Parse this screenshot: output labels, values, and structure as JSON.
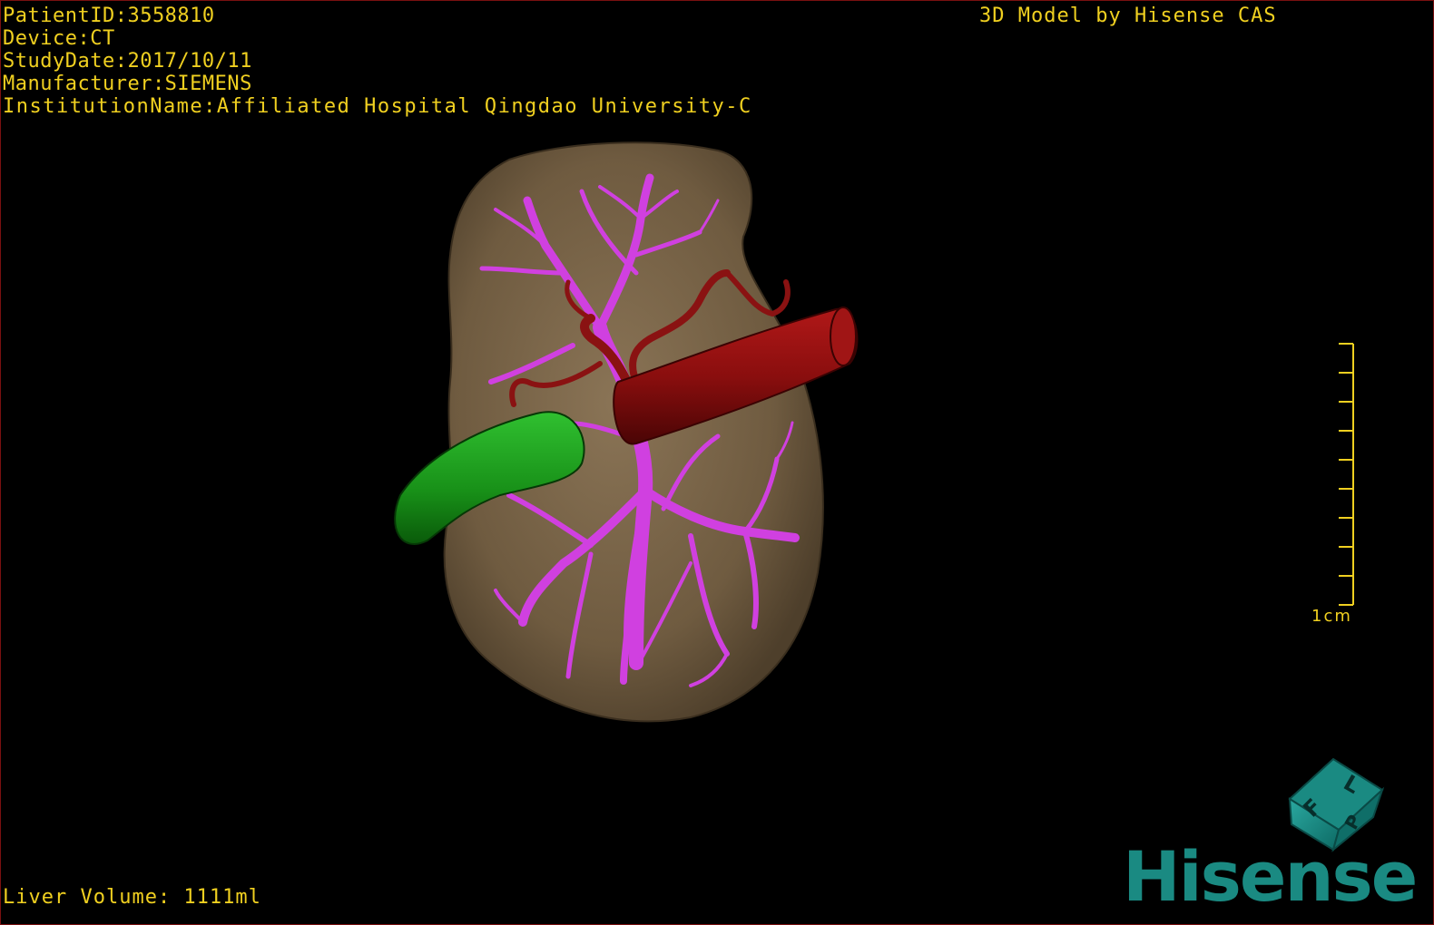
{
  "patient_info": {
    "patient_id": "PatientID:3558810",
    "device": "Device:CT",
    "study_date": "StudyDate:2017/10/11",
    "manufacturer": "Manufacturer:SIEMENS",
    "institution": "InstitutionName:Affiliated Hospital Qingdao University-C"
  },
  "header": {
    "model_credit": "3D Model by Hisense CAS"
  },
  "footer": {
    "liver_volume": "Liver Volume: 1111ml"
  },
  "scale_bar": {
    "label": "1cm"
  },
  "orientation_cube": {
    "faces": [
      "F",
      "L",
      "P"
    ]
  },
  "logo": {
    "text": "Hisense"
  },
  "colors": {
    "overlay_text": "#f0d020",
    "liver": "#7a6548",
    "portal_vein": "#d040e0",
    "artery": "#8a1010",
    "gallbladder": "#1aa01a",
    "brand": "#1a8a82"
  },
  "structures": [
    "liver",
    "portal-vein",
    "hepatic-artery",
    "aorta",
    "gallbladder"
  ]
}
